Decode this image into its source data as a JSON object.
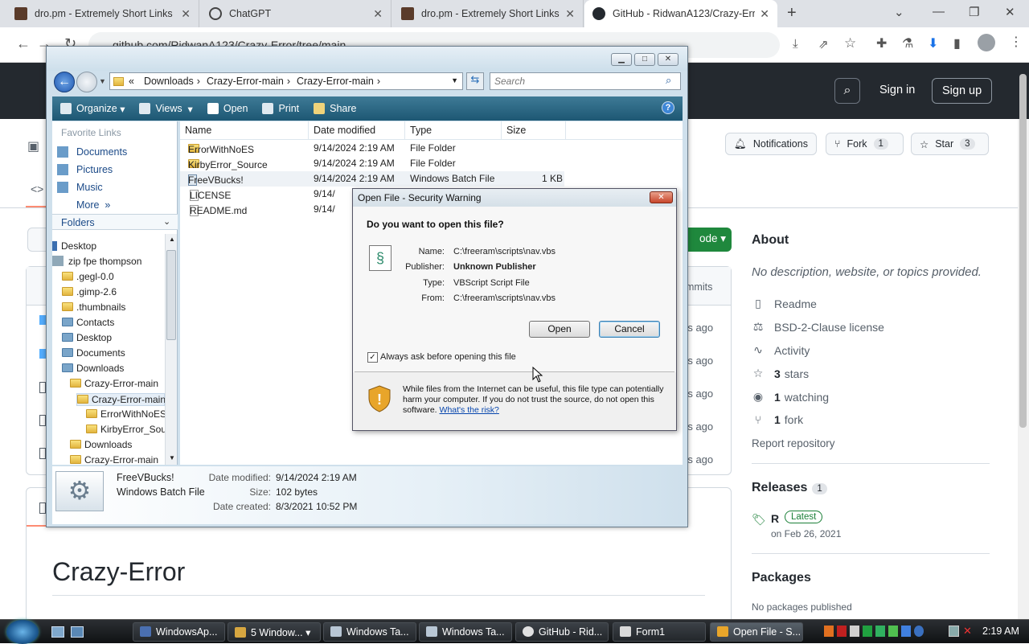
{
  "chrome": {
    "tabs": [
      {
        "title": "dro.pm - Extremely Short Links"
      },
      {
        "title": "ChatGPT"
      },
      {
        "title": "dro.pm - Extremely Short Links"
      },
      {
        "title": "GitHub - RidwanA123/Crazy-Error"
      }
    ],
    "new_tab": "+",
    "url": "github.com/RidwanA123/Crazy-Error/tree/main"
  },
  "github": {
    "sign_in": "Sign in",
    "sign_up": "Sign up",
    "notifications": "Notifications",
    "fork_label": "Fork",
    "fork_count": "1",
    "star_label": "Star",
    "star_count": "3",
    "code_button": "ode",
    "commits_text": "mmits",
    "ages": [
      "rs ago",
      "rs ago",
      "rs ago",
      "rs ago",
      "rs ago"
    ],
    "repo_title": "Crazy-Error",
    "about": {
      "heading": "About",
      "description": "No description, website, or topics provided.",
      "readme": "Readme",
      "license": "BSD-2-Clause license",
      "activity": "Activity",
      "stars_count": "3",
      "stars_label": "stars",
      "watching_count": "1",
      "watching_label": "watching",
      "fork_count": "1",
      "fork_label": "fork",
      "report": "Report repository"
    },
    "releases": {
      "heading": "Releases",
      "count": "1",
      "name": "R",
      "badge": "Latest",
      "date": "on Feb 26, 2021"
    },
    "packages": {
      "heading": "Packages",
      "text": "No packages published"
    }
  },
  "explorer": {
    "breadcrumb": [
      "«",
      "Downloads",
      "Crazy-Error-main",
      "Crazy-Error-main"
    ],
    "search_placeholder": "Search",
    "toolbar": {
      "organize": "Organize",
      "views": "Views",
      "open": "Open",
      "print": "Print",
      "share": "Share"
    },
    "favorites_title": "Favorite Links",
    "favorites": [
      "Documents",
      "Pictures",
      "Music"
    ],
    "more": "More",
    "folders_title": "Folders",
    "tree": [
      "Desktop",
      "zip fpe thompson",
      ".gegl-0.0",
      ".gimp-2.6",
      ".thumbnails",
      "Contacts",
      "Desktop",
      "Documents",
      "Downloads",
      "Crazy-Error-main",
      "Crazy-Error-main",
      "ErrorWithNoES",
      "KirbyError_Sou",
      "Downloads",
      "Crazy-Error-main"
    ],
    "columns": [
      "Name",
      "Date modified",
      "Type",
      "Size"
    ],
    "files": [
      {
        "name": "ErrorWithNoES",
        "date": "9/14/2024 2:19 AM",
        "type": "File Folder",
        "size": ""
      },
      {
        "name": "KirbyError_Source",
        "date": "9/14/2024 2:19 AM",
        "type": "File Folder",
        "size": ""
      },
      {
        "name": "FreeVBucks!",
        "date": "9/14/2024 2:19 AM",
        "type": "Windows Batch File",
        "size": "1 KB"
      },
      {
        "name": "LICENSE",
        "date": "9/14/",
        "type": "",
        "size": ""
      },
      {
        "name": "README.md",
        "date": "9/14/",
        "type": "",
        "size": ""
      }
    ],
    "details": {
      "name": "FreeVBucks!",
      "type": "Windows Batch File",
      "modified_label": "Date modified:",
      "modified": "9/14/2024 2:19 AM",
      "size_label": "Size:",
      "size": "102 bytes",
      "created_label": "Date created:",
      "created": "8/3/2021 10:52 PM"
    }
  },
  "dialog": {
    "title": "Open File - Security Warning",
    "question": "Do you want to open this file?",
    "name_label": "Name:",
    "name": "C:\\freeram\\scripts\\nav.vbs",
    "publisher_label": "Publisher:",
    "publisher": "Unknown Publisher",
    "type_label": "Type:",
    "type": "VBScript Script File",
    "from_label": "From:",
    "from": "C:\\freeram\\scripts\\nav.vbs",
    "open": "Open",
    "cancel": "Cancel",
    "checkbox_label": "Always ask before opening this file",
    "checkbox_checked": true,
    "warning": "While files from the Internet can be useful, this file type can potentially harm your computer. If you do not trust the source, do not open this software.",
    "risk_link": "What's the risk?"
  },
  "taskbar": {
    "buttons": [
      "WindowsAp...",
      "5 Window...",
      "Windows Ta...",
      "Windows Ta...",
      "GitHub - Rid...",
      "Form1",
      "Open File - S..."
    ],
    "clock": "2:19 AM"
  }
}
